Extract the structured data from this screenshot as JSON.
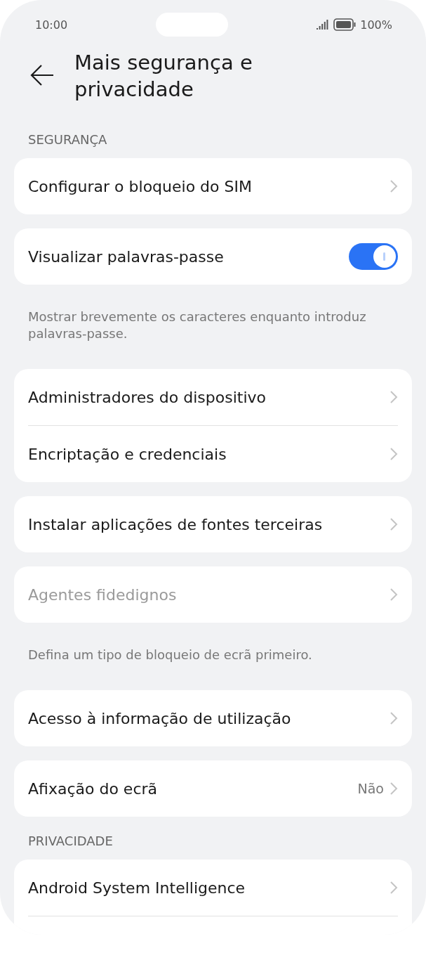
{
  "status_bar": {
    "time": "10:00",
    "battery": "100%"
  },
  "header": {
    "title": "Mais segurança e privacidade"
  },
  "sections": [
    {
      "kind": "header",
      "text": "SEGURANÇA"
    },
    {
      "kind": "card",
      "rows": [
        {
          "kind": "chevron",
          "label": "Configurar o bloqueio do SIM",
          "disabled": false
        }
      ]
    },
    {
      "kind": "card",
      "rows": [
        {
          "kind": "toggle",
          "label": "Visualizar palavras-passe",
          "on": true
        }
      ]
    },
    {
      "kind": "note",
      "text": "Mostrar brevemente os caracteres enquanto introduz palavras-passe."
    },
    {
      "kind": "card",
      "rows": [
        {
          "kind": "chevron",
          "label": "Administradores do dispositivo",
          "disabled": false
        },
        {
          "kind": "chevron",
          "label": "Encriptação e credenciais",
          "disabled": false
        }
      ]
    },
    {
      "kind": "card",
      "rows": [
        {
          "kind": "chevron",
          "label": "Instalar aplicações de fontes terceiras",
          "disabled": false
        }
      ]
    },
    {
      "kind": "card",
      "rows": [
        {
          "kind": "chevron",
          "label": "Agentes fidedignos",
          "disabled": true
        }
      ]
    },
    {
      "kind": "note",
      "text": "Defina um tipo de bloqueio de ecrã primeiro."
    },
    {
      "kind": "card",
      "rows": [
        {
          "kind": "chevron",
          "label": "Acesso à informação de utilização",
          "disabled": false
        }
      ]
    },
    {
      "kind": "card",
      "rows": [
        {
          "kind": "chevron",
          "label": "Afixação do ecrã",
          "value": "Não",
          "disabled": false
        }
      ]
    },
    {
      "kind": "header",
      "text": "PRIVACIDADE"
    },
    {
      "kind": "card",
      "cut_off": true,
      "rows": [
        {
          "kind": "chevron",
          "label": "Android System Intelligence",
          "disabled": false
        }
      ]
    }
  ]
}
